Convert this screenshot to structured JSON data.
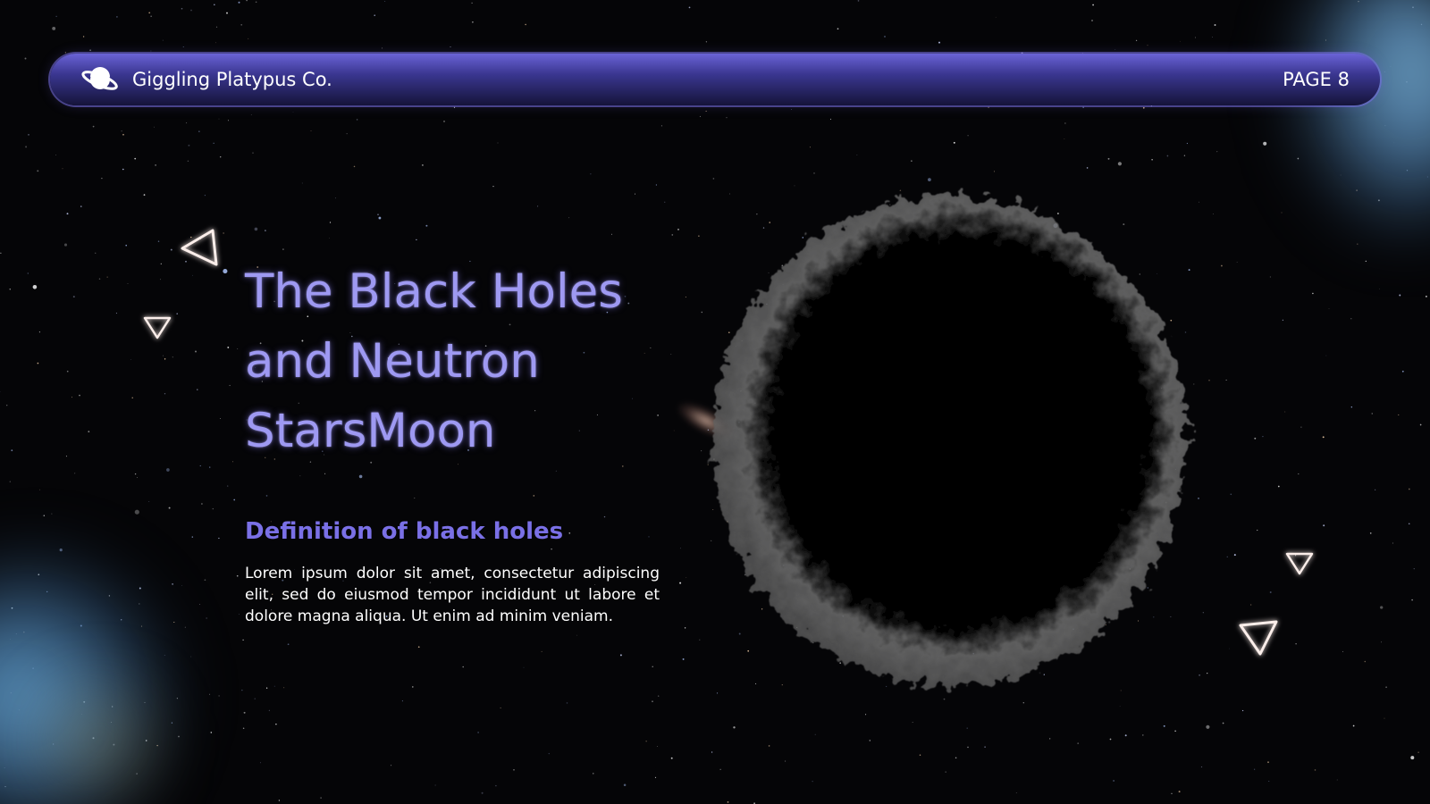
{
  "header": {
    "company": "Giggling Platypus Co.",
    "page": "PAGE 8",
    "logo_icon": "planet-icon"
  },
  "title": "The Black Holes and Neutron StarsMoon",
  "subtitle": "Definition of black holes",
  "body": "Lorem ipsum dolor sit amet, consectetur adipiscing elit, sed do eiusmod tempor incididunt ut labore et dolore magna aliqua. Ut enim ad minim veniam.",
  "colors": {
    "accent": "#7a70e6",
    "title": "#9e99f2",
    "header_top": "#6a63d6",
    "header_bottom": "#15143a",
    "background": "#050507"
  },
  "decorations": [
    "triangle-outline-icon",
    "triangle-outline-icon",
    "triangle-outline-icon",
    "triangle-outline-icon"
  ]
}
